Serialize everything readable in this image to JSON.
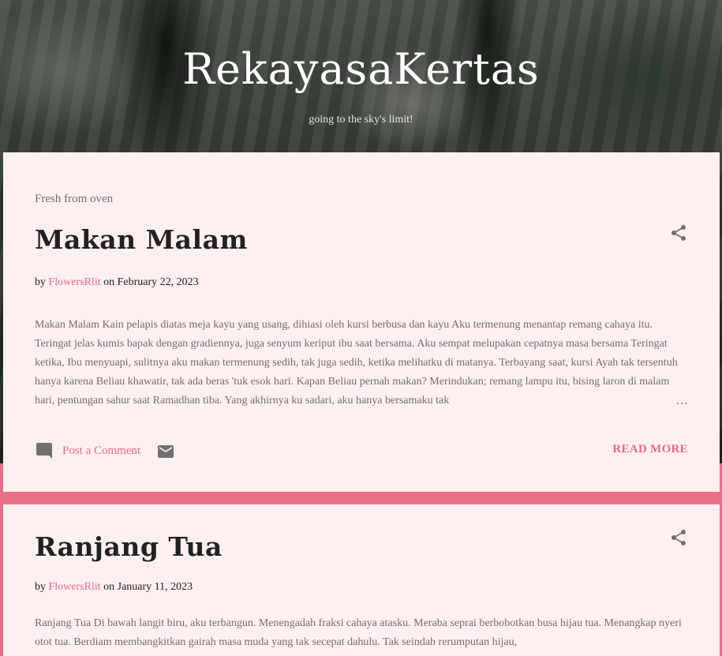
{
  "header": {
    "title": "RekayasaKertas",
    "description": "going to the sky's limit!"
  },
  "section_label": "Fresh from oven",
  "posts": [
    {
      "title": "Makan Malam",
      "by": "by",
      "author": "FlowersRlit",
      "on": "on",
      "date": "February 22, 2023",
      "snippet": "Makan Malam Kain pelapis diatas meja kayu yang usang, dihiasi oleh kursi berbusa dan kayu Aku termenung menantap remang cahaya itu. Teringat jelas kumis bapak dengan gradiennya, juga senyum keriput ibu saat bersama. Aku sempat melupakan cepatnya masa bersama Teringat ketika, Ibu menyuapi, sulitnya aku makan termenung sedih, tak juga sedih, ketika melihatku di matanya. Terbayang saat, kursi Ayah tak tersentuh hanya karena Beliau khawatir, tak ada beras 'tuk esok hari. Kapan Beliau pernah makan? Merindukan; remang lampu itu, bising laron di malam hari, pentungan sahur saat Ramadhan tiba. Yang akhirnya ku sadari, aku hanya bersamaku tak",
      "ellipsis": "…",
      "comment_label": "Post a Comment",
      "read_more": "READ MORE"
    },
    {
      "title": "Ranjang Tua",
      "by": "by",
      "author": "FlowersRlit",
      "on": "on",
      "date": "January 11, 2023",
      "snippet": "Ranjang Tua Di bawah langit biru, aku terbangun.  Menengadah fraksi cahaya atasku.  Meraba seprai berbobotkan busa hijau tua. Menangkap nyeri otot tua.  Berdiam  membangkitkan gairah masa muda  yang tak secepat dahulu.  Tak seindah rerumputan hijau,"
    }
  ],
  "icons": {
    "share": "share-icon",
    "comment": "comment-icon",
    "mail": "mail-icon"
  },
  "colors": {
    "accent": "#e06b86",
    "page_bg": "#ea6f86",
    "card_bg": "#fff0f0",
    "title_text": "#212121",
    "body_text": "#6f6f6f"
  }
}
